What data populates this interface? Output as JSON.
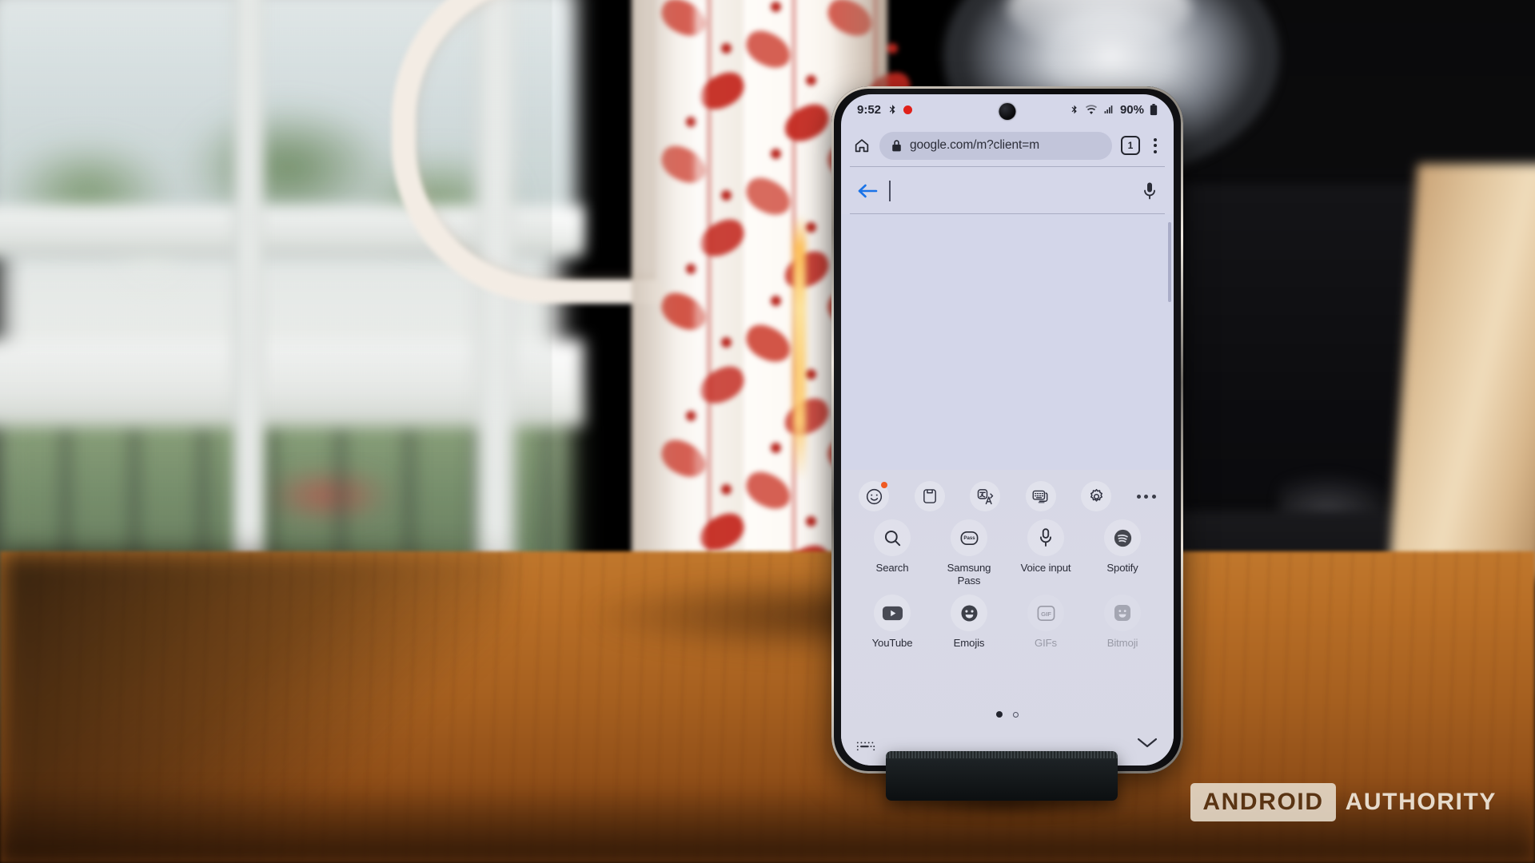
{
  "scene": {
    "description": "Samsung smartphone on a black stand on a wooden table, blurred window and red-leaf ceramic pitcher behind",
    "colors": {
      "screen_bg": "#d3d6e9",
      "keyboard_bg": "#d7d8e6",
      "accent_blue": "#1a73e8",
      "badge_orange": "#ef5a22",
      "table_wood": "#b86e26",
      "pitcher_red": "#c3281f"
    }
  },
  "phone": {
    "status_bar": {
      "time": "9:52",
      "left_icons": [
        "bluetooth-share-icon",
        "record-dot-icon"
      ],
      "right_icons": [
        "bluetooth-icon",
        "wifi-icon",
        "signal-icon"
      ],
      "battery_percent": "90%",
      "battery_icon": "battery-icon"
    },
    "browser": {
      "home_icon": "home-icon",
      "lock_icon": "lock-icon",
      "url": "google.com/m?client=m",
      "tab_count": "1",
      "menu_icon": "kebab-menu-icon"
    },
    "search": {
      "back_icon": "back-arrow-icon",
      "value": "",
      "placeholder": "",
      "mic_icon": "microphone-icon"
    },
    "keyboard": {
      "toolbar": [
        {
          "name": "emoji-sticker-icon",
          "label": "Emoji",
          "badge": true
        },
        {
          "name": "clipboard-icon",
          "label": "Clipboard",
          "badge": false
        },
        {
          "name": "translate-icon",
          "label": "Translate",
          "badge": false
        },
        {
          "name": "keyboard-modes-icon",
          "label": "Modes",
          "badge": false
        },
        {
          "name": "settings-gear-icon",
          "label": "Settings",
          "badge": false
        },
        {
          "name": "more-options-icon",
          "label": "More",
          "badge": false
        }
      ],
      "apps": [
        [
          {
            "label": "Search",
            "icon": "search-icon",
            "enabled": true
          },
          {
            "label": "Samsung Pass",
            "icon": "samsung-pass-icon",
            "enabled": true
          },
          {
            "label": "Voice input",
            "icon": "voice-input-icon",
            "enabled": true
          },
          {
            "label": "Spotify",
            "icon": "spotify-icon",
            "enabled": true
          }
        ],
        [
          {
            "label": "YouTube",
            "icon": "youtube-icon",
            "enabled": true
          },
          {
            "label": "Emojis",
            "icon": "emojis-icon",
            "enabled": true
          },
          {
            "label": "GIFs",
            "icon": "gif-icon",
            "enabled": false
          },
          {
            "label": "Bitmoji",
            "icon": "bitmoji-icon",
            "enabled": false
          }
        ]
      ],
      "pages": {
        "total": 2,
        "current": 1
      },
      "keyboard_toggle_icon": "keyboard-icon",
      "collapse_icon": "chevron-down-icon"
    }
  },
  "watermark": {
    "brand_boxed": "ANDROID",
    "brand_plain": "AUTHORITY"
  }
}
